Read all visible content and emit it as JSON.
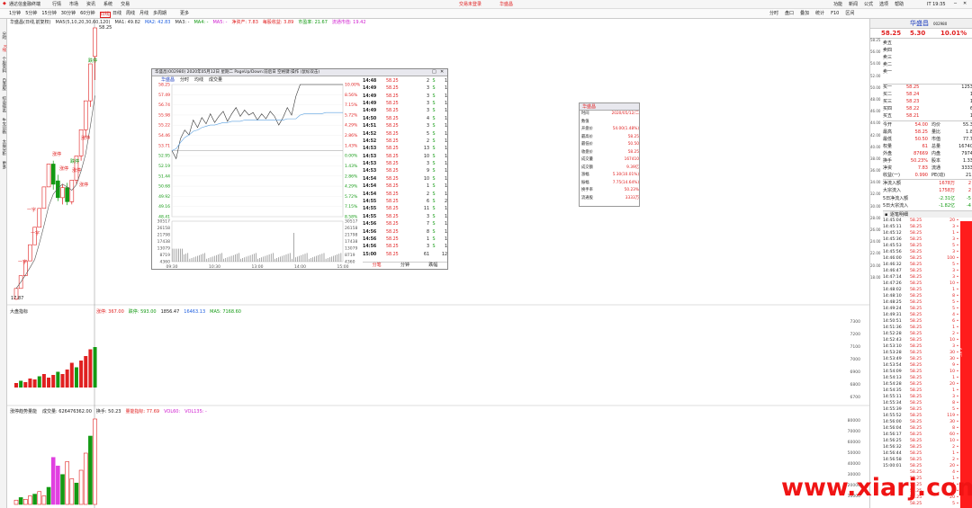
{
  "titlebar": {
    "app_title": "通达信金融终端",
    "menus": [
      "行情",
      "市场",
      "资讯",
      "系统",
      "交易"
    ],
    "account": "交易未登录",
    "stock_name": "华盛昌",
    "right_items": [
      "功能",
      "新闻",
      "公式",
      "选项",
      "帮助"
    ],
    "clock": "IT 19:35"
  },
  "toolbar": {
    "periods": [
      "日线",
      "周线",
      "月线",
      "多周期"
    ],
    "tools": [
      "更多"
    ],
    "right_tools": [
      "分时",
      "盘口",
      "叠加",
      "统计",
      "F10",
      "区间"
    ],
    "minutes": [
      "1分钟",
      "5分钟",
      "15分钟",
      "30分钟",
      "60分钟",
      "日线"
    ]
  },
  "left_sidebar": {
    "items": [
      "分时",
      "K线",
      "个股资料",
      "自选股",
      "综合排名",
      "牛叉诊断",
      "大盘分析",
      "更多"
    ]
  },
  "kline": {
    "header": "华盛昌(日线,前复权)",
    "ma": [
      {
        "label": "MA5(5,10,20,30,60,120)",
        "value": "",
        "color": "#333333"
      },
      {
        "label": "MA1",
        "value": "49.82",
        "color": "#333333"
      },
      {
        "label": "MA2",
        "value": "42.83",
        "color": "#2060e0"
      },
      {
        "label": "MA3",
        "value": "-",
        "color": "#333333"
      },
      {
        "label": "MA4",
        "value": "-",
        "color": "#139a13"
      },
      {
        "label": "MA5",
        "value": "-",
        "color": "#d020d0"
      }
    ],
    "extras": [
      {
        "label": "净资产",
        "value": "7.83",
        "color": "#e02020"
      },
      {
        "label": "每股收益",
        "value": "3.89",
        "color": "#e02020"
      },
      {
        "label": "市盈率",
        "value": "21.67",
        "color": "#139a13"
      },
      {
        "label": "流通市值",
        "value": "19.42",
        "color": "#d020d0"
      }
    ],
    "high_label": "58.25",
    "low_label": "17.87",
    "labels": [
      "涨停",
      "涨停",
      "一字",
      "一字",
      "一字",
      "涨停",
      "涨停",
      "涨停",
      "跌停",
      "跌停"
    ]
  },
  "indicator1": {
    "header": "大盘指标",
    "values": [
      {
        "label": "涨停",
        "value": "367.00",
        "color": "#e02020"
      },
      {
        "label": "跌停",
        "value": "593.00",
        "color": "#139a13"
      },
      {
        "label": "",
        "value": "1856.47",
        "color": "#222222"
      },
      {
        "label": "",
        "value": "16463.13",
        "color": "#2060e0"
      },
      {
        "label": "MA5",
        "value": "7168.60",
        "color": "#139a13"
      }
    ],
    "scale": [
      "7300",
      "7200",
      "7100",
      "7000",
      "6900",
      "6800",
      "6700"
    ]
  },
  "indicator2": {
    "header": "涨停趋势量能",
    "values": [
      {
        "label": "成交量",
        "value": "626476362.00",
        "color": "#222222"
      },
      {
        "label": "换手",
        "value": "50.23",
        "color": "#222222"
      },
      {
        "label": "量能指标",
        "value": "77.69",
        "color": "#e02020"
      },
      {
        "label": "VOL60",
        "value": "",
        "color": "#d020d0"
      },
      {
        "label": "VOL135",
        "value": "-",
        "color": "#d020d0"
      }
    ],
    "scale": [
      "80000",
      "70000",
      "60000",
      "50000",
      "40000",
      "30000",
      "20000",
      "10000"
    ]
  },
  "popup": {
    "title": "华盛昌(002980) 2020年05月12日 星期二 PageUp/Down:前后日 空格键:操作 (鼠标双击)",
    "tabs": [
      "华盛昌",
      "分时",
      "均线",
      "成交量"
    ],
    "price_scale_left": [
      "58.25",
      "57.49",
      "56.74",
      "55.98",
      "55.22",
      "54.46",
      "53.71",
      "52.95",
      "52.19",
      "51.44",
      "50.68",
      "49.92",
      "49.16",
      "48.41"
    ],
    "pct_scale_right": [
      "10.00%",
      "8.56%",
      "7.15%",
      "5.72%",
      "4.29%",
      "2.86%",
      "1.43%",
      "0.00%",
      "1.43%",
      "2.86%",
      "4.29%",
      "5.72%",
      "7.15%",
      "8.58%"
    ],
    "vol_scale": [
      "30517",
      "26158",
      "21798",
      "17438",
      "13079",
      "8719",
      "4360"
    ],
    "time_axis": [
      "09:30",
      "10:30",
      "13:00",
      "14:00",
      "15:00"
    ],
    "trades": [
      {
        "t": "14:48",
        "p": "58.25",
        "v": "2",
        "d": "S",
        "n": "1"
      },
      {
        "t": "14:49",
        "p": "58.25",
        "v": "3",
        "d": "S",
        "n": "1"
      },
      {
        "t": "14:49",
        "p": "58.25",
        "v": "3",
        "d": "S",
        "n": "1"
      },
      {
        "t": "14:49",
        "p": "58.25",
        "v": "3",
        "d": "S",
        "n": "1"
      },
      {
        "t": "14:49",
        "p": "58.25",
        "v": "3",
        "d": "S",
        "n": "1"
      },
      {
        "t": "14:50",
        "p": "58.25",
        "v": "4",
        "d": "S",
        "n": "1"
      },
      {
        "t": "14:51",
        "p": "58.25",
        "v": "3",
        "d": "S",
        "n": "1"
      },
      {
        "t": "14:52",
        "p": "58.25",
        "v": "5",
        "d": "S",
        "n": "1"
      },
      {
        "t": "14:52",
        "p": "58.25",
        "v": "2",
        "d": "S",
        "n": "1"
      },
      {
        "t": "14:53",
        "p": "58.25",
        "v": "13",
        "d": "S",
        "n": "1"
      },
      {
        "t": "14:53",
        "p": "58.25",
        "v": "10",
        "d": "S",
        "n": "1"
      },
      {
        "t": "14:53",
        "p": "58.25",
        "v": "3",
        "d": "S",
        "n": "1"
      },
      {
        "t": "14:53",
        "p": "58.25",
        "v": "9",
        "d": "S",
        "n": "1"
      },
      {
        "t": "14:54",
        "p": "58.25",
        "v": "10",
        "d": "S",
        "n": "1"
      },
      {
        "t": "14:54",
        "p": "58.25",
        "v": "1",
        "d": "S",
        "n": "1"
      },
      {
        "t": "14:54",
        "p": "58.25",
        "v": "2",
        "d": "S",
        "n": "1"
      },
      {
        "t": "14:55",
        "p": "58.25",
        "v": "6",
        "d": "S",
        "n": "2"
      },
      {
        "t": "14:55",
        "p": "58.25",
        "v": "11",
        "d": "S",
        "n": "1"
      },
      {
        "t": "14:55",
        "p": "58.25",
        "v": "3",
        "d": "S",
        "n": "1"
      },
      {
        "t": "14:56",
        "p": "58.25",
        "v": "7",
        "d": "S",
        "n": "1"
      },
      {
        "t": "14:56",
        "p": "58.25",
        "v": "8",
        "d": "S",
        "n": "1"
      },
      {
        "t": "14:56",
        "p": "58.25",
        "v": "1",
        "d": "S",
        "n": "1"
      },
      {
        "t": "14:56",
        "p": "58.25",
        "v": "3",
        "d": "S",
        "n": "1"
      },
      {
        "t": "15:00",
        "p": "58.25",
        "v": "61",
        "d": "",
        "n": "12"
      }
    ],
    "footer_tabs": [
      "分笔",
      "分钟",
      "跌幅"
    ]
  },
  "infobox": {
    "title": "华盛昌",
    "rows": [
      {
        "k": "时间",
        "v": "2020/05/12/二"
      },
      {
        "k": "数值",
        "v": ""
      },
      {
        "k": "开盘价",
        "v": "54.00(1.48%)"
      },
      {
        "k": "最高价",
        "v": "58.25"
      },
      {
        "k": "最低价",
        "v": "50.50"
      },
      {
        "k": "收盘价",
        "v": "58.25"
      },
      {
        "k": "成交量",
        "v": "167410"
      },
      {
        "k": "成交额",
        "v": "9.39亿"
      },
      {
        "k": "涨幅",
        "v": "5.30(10.01%)"
      },
      {
        "k": "振幅",
        "v": "7.75(14.64%)"
      },
      {
        "k": "换手率",
        "v": "50.23%"
      },
      {
        "k": "流通股",
        "v": "3333万"
      }
    ]
  },
  "quote": {
    "name": "华盛昌",
    "code": "002980",
    "price": "58.25",
    "change": "5.30",
    "pct": "10.01%",
    "asks": [
      {
        "l": "卖五",
        "p": "",
        "v": ""
      },
      {
        "l": "卖四",
        "p": "",
        "v": ""
      },
      {
        "l": "卖三",
        "p": "",
        "v": ""
      },
      {
        "l": "卖二",
        "p": "",
        "v": ""
      },
      {
        "l": "卖一",
        "p": "",
        "v": ""
      }
    ],
    "bids": [
      {
        "l": "买一",
        "p": "58.25",
        "v": "1253"
      },
      {
        "l": "买二",
        "p": "58.24",
        "v": "1"
      },
      {
        "l": "买三",
        "p": "58.23",
        "v": "1"
      },
      {
        "l": "买四",
        "p": "58.22",
        "v": "6"
      },
      {
        "l": "买五",
        "p": "58.21",
        "v": "1"
      }
    ],
    "stats": [
      {
        "k1": "今开",
        "v1": "54.00",
        "k2": "均价",
        "v2": "55.3"
      },
      {
        "k1": "最高",
        "v1": "58.25",
        "k2": "量比",
        "v2": "1.8"
      },
      {
        "k1": "最低",
        "v1": "50.50",
        "k2": "市值",
        "v2": "77.7"
      },
      {
        "k1": "权量",
        "v1": "61",
        "k2": "总量",
        "v2": "16740"
      },
      {
        "k1": "外盘",
        "v1": "87669",
        "k2": "内盘",
        "v2": "7974"
      },
      {
        "k1": "换手",
        "v1": "50.23%",
        "k2": "股本",
        "v2": "1.33"
      },
      {
        "k1": "净资",
        "v1": "7.83",
        "k2": "流通",
        "v2": "3333"
      },
      {
        "k1": "收益(一)",
        "v1": "0.990",
        "k2": "PE(动)",
        "v2": "21."
      }
    ],
    "flows": [
      {
        "k": "净流入额",
        "v": "1678万",
        "r": "2"
      },
      {
        "k": "大宗流入",
        "v": "1758万",
        "r": "2"
      },
      {
        "k": "5日净流入额",
        "v": "-2.31亿",
        "r": "-5"
      },
      {
        "k": "5日大宗流入",
        "v": "-1.82亿",
        "r": "-4"
      }
    ],
    "tick_header": "逐笔明细",
    "ticks": [
      {
        "t": "14:45:04",
        "p": "58.25",
        "v": "20"
      },
      {
        "t": "14:45:11",
        "p": "58.25",
        "v": "3"
      },
      {
        "t": "14:45:12",
        "p": "58.25",
        "v": "1"
      },
      {
        "t": "14:45:36",
        "p": "58.25",
        "v": "3"
      },
      {
        "t": "14:45:53",
        "p": "58.25",
        "v": "5"
      },
      {
        "t": "14:45:56",
        "p": "58.25",
        "v": "3"
      },
      {
        "t": "14:46:00",
        "p": "58.25",
        "v": "100"
      },
      {
        "t": "14:46:32",
        "p": "58.25",
        "v": "5"
      },
      {
        "t": "14:46:47",
        "p": "58.25",
        "v": "3"
      },
      {
        "t": "14:47:14",
        "p": "58.25",
        "v": "3"
      },
      {
        "t": "14:47:26",
        "p": "58.25",
        "v": "10"
      },
      {
        "t": "14:48:02",
        "p": "58.25",
        "v": "1"
      },
      {
        "t": "14:48:10",
        "p": "58.25",
        "v": "8"
      },
      {
        "t": "14:48:25",
        "p": "58.25",
        "v": "5"
      },
      {
        "t": "14:49:24",
        "p": "58.25",
        "v": "5"
      },
      {
        "t": "14:49:31",
        "p": "58.25",
        "v": "4"
      },
      {
        "t": "14:50:51",
        "p": "58.25",
        "v": "6"
      },
      {
        "t": "14:51:36",
        "p": "58.25",
        "v": "1"
      },
      {
        "t": "14:52:28",
        "p": "58.25",
        "v": "2"
      },
      {
        "t": "14:52:43",
        "p": "58.25",
        "v": "10"
      },
      {
        "t": "14:53:10",
        "p": "58.25",
        "v": "3"
      },
      {
        "t": "14:53:28",
        "p": "58.25",
        "v": "30"
      },
      {
        "t": "14:53:49",
        "p": "58.25",
        "v": "30"
      },
      {
        "t": "14:53:54",
        "p": "58.25",
        "v": "9"
      },
      {
        "t": "14:54:09",
        "p": "58.25",
        "v": "10"
      },
      {
        "t": "14:54:13",
        "p": "58.25",
        "v": "1"
      },
      {
        "t": "14:54:28",
        "p": "58.25",
        "v": "20"
      },
      {
        "t": "14:54:35",
        "p": "58.25",
        "v": "1"
      },
      {
        "t": "14:55:11",
        "p": "58.25",
        "v": "3"
      },
      {
        "t": "14:55:34",
        "p": "58.25",
        "v": "8"
      },
      {
        "t": "14:55:39",
        "p": "58.25",
        "v": "5"
      },
      {
        "t": "14:55:52",
        "p": "58.25",
        "v": "119"
      },
      {
        "t": "14:56:00",
        "p": "58.25",
        "v": "30"
      },
      {
        "t": "14:56:04",
        "p": "58.25",
        "v": "8"
      },
      {
        "t": "14:56:17",
        "p": "58.25",
        "v": "60"
      },
      {
        "t": "14:56:25",
        "p": "58.25",
        "v": "10"
      },
      {
        "t": "14:56:32",
        "p": "58.25",
        "v": "2"
      },
      {
        "t": "14:56:44",
        "p": "58.25",
        "v": "1"
      },
      {
        "t": "14:56:58",
        "p": "58.25",
        "v": "2"
      },
      {
        "t": "15:00:01",
        "p": "58.25",
        "v": "20"
      },
      {
        "t": "",
        "p": "58.25",
        "v": "4"
      },
      {
        "t": "",
        "p": "58.25",
        "v": "1"
      },
      {
        "t": "",
        "p": "58.25",
        "v": "1"
      },
      {
        "t": "",
        "p": "58.25",
        "v": "1"
      },
      {
        "t": "",
        "p": "58.25",
        "v": "20"
      },
      {
        "t": "",
        "p": "58.25",
        "v": "5"
      }
    ],
    "side_scale": [
      "58.25",
      "56.00",
      "54.00",
      "52.00",
      "50.00",
      "48.00",
      "46.00",
      "44.00",
      "42.00",
      "40.00",
      "38.00",
      "36.00",
      "34.00",
      "32.00",
      "30.00",
      "28.00",
      "26.00",
      "24.00",
      "22.00",
      "20.00",
      "18.00"
    ],
    "bar_label": "6,8万"
  },
  "watermark": "www.xiarj.com",
  "colors": {
    "up": "#e02020",
    "down": "#139a13",
    "accent": "#2040c0"
  },
  "kline_candles": [
    {
      "o": 17.9,
      "c": 19.5,
      "h": 19.5,
      "l": 17.8
    },
    {
      "o": 19.5,
      "c": 21.4,
      "h": 21.4,
      "l": 19.5
    },
    {
      "o": 21.4,
      "c": 23.6,
      "h": 23.6,
      "l": 21.4
    },
    {
      "o": 23.6,
      "c": 26.0,
      "h": 26.0,
      "l": 23.6
    },
    {
      "o": 26.0,
      "c": 28.6,
      "h": 28.6,
      "l": 26.0
    },
    {
      "o": 28.6,
      "c": 31.4,
      "h": 31.4,
      "l": 28.6
    },
    {
      "o": 31.4,
      "c": 34.6,
      "h": 34.6,
      "l": 31.4
    },
    {
      "o": 34.6,
      "c": 38.0,
      "h": 38.0,
      "l": 34.6
    },
    {
      "o": 38.0,
      "c": 35.0,
      "h": 38.5,
      "l": 34.2
    },
    {
      "o": 35.5,
      "c": 33.0,
      "h": 36.4,
      "l": 32.5
    },
    {
      "o": 33.0,
      "c": 34.5,
      "h": 35.0,
      "l": 32.0
    },
    {
      "o": 34.5,
      "c": 32.4,
      "h": 35.2,
      "l": 31.9
    },
    {
      "o": 32.4,
      "c": 35.6,
      "h": 35.6,
      "l": 32.0
    },
    {
      "o": 35.6,
      "c": 39.2,
      "h": 39.2,
      "l": 35.0
    },
    {
      "o": 39.2,
      "c": 43.1,
      "h": 43.1,
      "l": 38.5
    },
    {
      "o": 43.1,
      "c": 47.4,
      "h": 47.4,
      "l": 42.0
    },
    {
      "o": 47.4,
      "c": 52.9,
      "h": 52.9,
      "l": 46.5
    },
    {
      "o": 54.0,
      "c": 58.25,
      "h": 58.25,
      "l": 50.5
    }
  ],
  "intraday": {
    "price": [
      52.95,
      52.3,
      53.9,
      54.6,
      54.2,
      55.4,
      54.8,
      55.6,
      55.1,
      55.9,
      55.2,
      55.7,
      56.1,
      55.3,
      55.9,
      56.4,
      55.7,
      56.2,
      55.8,
      56.0,
      55.4,
      55.9,
      55.5,
      56.1,
      55.7,
      55.0,
      55.6,
      56.4,
      55.8,
      57.3,
      58.25,
      58.25,
      58.25,
      58.25,
      58.25,
      58.25,
      58.25,
      58.25,
      58.25,
      58.25,
      58.25
    ],
    "avg": [
      52.95,
      53.1,
      53.6,
      54.0,
      54.2,
      54.5,
      54.6,
      54.8,
      54.9,
      55.0,
      55.0,
      55.1,
      55.2,
      55.2,
      55.3,
      55.3,
      55.3,
      55.4,
      55.4,
      55.4,
      55.4,
      55.4,
      55.4,
      55.4,
      55.4,
      55.4,
      55.4,
      55.5,
      55.5,
      55.5,
      55.8,
      55.9,
      55.9,
      55.9,
      55.9,
      55.9,
      56.0,
      56.0,
      56.0,
      56.0,
      56.0
    ],
    "prev_close": 52.95,
    "ymin": 47.65,
    "ymax": 58.25
  }
}
